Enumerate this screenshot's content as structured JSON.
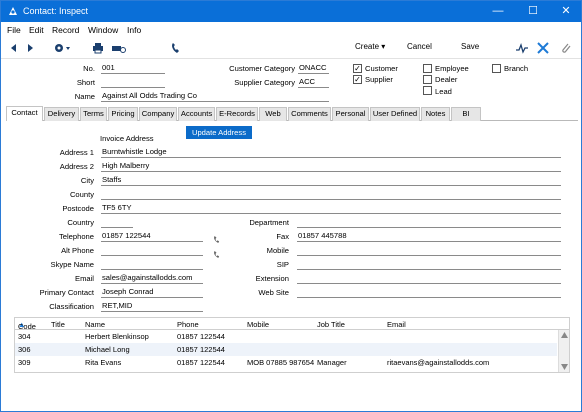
{
  "window": {
    "title": "Contact: Inspect"
  },
  "menu": [
    "File",
    "Edit",
    "Record",
    "Window",
    "Info"
  ],
  "toolbar": {
    "create": "Create",
    "cancel": "Cancel",
    "save": "Save"
  },
  "header": {
    "no_label": "No.",
    "no_value": "001",
    "short_label": "Short",
    "short_value": "",
    "name_label": "Name",
    "name_value": "Against All Odds Trading Co",
    "cust_cat_label": "Customer Category",
    "cust_cat_value": "ONACC",
    "supp_cat_label": "Supplier Category",
    "supp_cat_value": "ACC",
    "checkboxes": [
      {
        "label": "Customer",
        "checked": true
      },
      {
        "label": "Supplier",
        "checked": true
      },
      {
        "label": "Employee",
        "checked": false
      },
      {
        "label": "Dealer",
        "checked": false
      },
      {
        "label": "Lead",
        "checked": false
      },
      {
        "label": "Branch",
        "checked": false
      }
    ],
    "check_mark": "✓"
  },
  "tabs": [
    "Contact",
    "Delivery",
    "Terms",
    "Pricing",
    "Company",
    "Accounts",
    "E-Records",
    "Web",
    "Comments",
    "Personal",
    "User Defined",
    "Notes",
    "BI"
  ],
  "form": {
    "invoice_address_label": "Invoice Address",
    "update_button": "Update Address",
    "address1_label": "Address 1",
    "address1": "Burntwhistle Lodge",
    "address2_label": "Address 2",
    "address2": "High Malberry",
    "city_label": "City",
    "city": "Staffs",
    "county_label": "County",
    "county": "",
    "postcode_label": "Postcode",
    "postcode": "TF5 6TY",
    "country_label": "Country",
    "country": "",
    "department_label": "Department",
    "department": "",
    "telephone_label": "Telephone",
    "telephone": "01857 122544",
    "fax_label": "Fax",
    "fax": "01857 445788",
    "altphone_label": "Alt Phone",
    "altphone": "",
    "mobile_label": "Mobile",
    "mobile": "",
    "skype_label": "Skype Name",
    "skype": "",
    "sip_label": "SIP",
    "sip": "",
    "email_label": "Email",
    "email": "sales@againstallodds.com",
    "extension_label": "Extension",
    "extension": "",
    "primary_label": "Primary Contact",
    "primary": "Joseph Conrad",
    "website_label": "Web Site",
    "website": "",
    "class_label": "Classification",
    "classification": "RET,MID"
  },
  "grid": {
    "columns": [
      "Code",
      "Title",
      "Name",
      "Phone",
      "Mobile",
      "Job Title",
      "Email"
    ],
    "rows": [
      {
        "code": "304",
        "title": "",
        "name": "Herbert Blenkinsop",
        "phone": "01857 122544",
        "mobile": "",
        "job": "",
        "email": ""
      },
      {
        "code": "306",
        "title": "",
        "name": "Michael Long",
        "phone": "01857 122544",
        "mobile": "",
        "job": "",
        "email": ""
      },
      {
        "code": "309",
        "title": "",
        "name": "Rita Evans",
        "phone": "01857 122544",
        "mobile": "MOB 07885 987654",
        "job": "Manager",
        "email": "ritaevans@againstallodds.com"
      }
    ]
  },
  "colors": {
    "titlebar": "#0a6fd8",
    "accent_button": "#0b6bc9"
  }
}
